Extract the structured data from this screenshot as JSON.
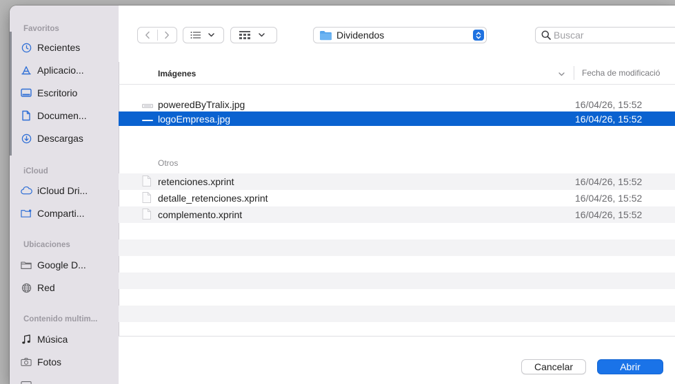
{
  "sidebar": {
    "favorites_header": "Favoritos",
    "favorites": [
      {
        "label": "Recientes",
        "icon": "clock-icon"
      },
      {
        "label": "Aplicacio...",
        "icon": "applications-icon"
      },
      {
        "label": "Escritorio",
        "icon": "desktop-icon"
      },
      {
        "label": "Documen...",
        "icon": "document-icon"
      },
      {
        "label": "Descargas",
        "icon": "download-icon"
      }
    ],
    "icloud_header": "iCloud",
    "icloud": [
      {
        "label": "iCloud Dri...",
        "icon": "cloud-icon"
      },
      {
        "label": "Comparti...",
        "icon": "shared-folder-icon"
      }
    ],
    "locations_header": "Ubicaciones",
    "locations": [
      {
        "label": "Google D...",
        "icon": "drive-icon"
      },
      {
        "label": "Red",
        "icon": "network-icon"
      }
    ],
    "media_header": "Contenido multim...",
    "media": [
      {
        "label": "Música",
        "icon": "music-icon"
      },
      {
        "label": "Fotos",
        "icon": "camera-icon"
      }
    ]
  },
  "toolbar": {
    "location": "Dividendos",
    "search_placeholder": "Buscar"
  },
  "list": {
    "name_header": "Imágenes",
    "date_header": "Fecha de modificació",
    "images": [
      {
        "name": "poweredByTralix.jpg",
        "date": "16/04/26, 15:52",
        "selected": false
      },
      {
        "name": "logoEmpresa.jpg",
        "date": "16/04/26, 15:52",
        "selected": true
      }
    ],
    "others_label": "Otros",
    "others": [
      {
        "name": "retenciones.xprint",
        "date": "16/04/26, 15:52"
      },
      {
        "name": "detalle_retenciones.xprint",
        "date": "16/04/26, 15:52"
      },
      {
        "name": "complemento.xprint",
        "date": "16/04/26, 15:52"
      }
    ]
  },
  "footer": {
    "cancel_label": "Cancelar",
    "open_label": "Abrir"
  },
  "colors": {
    "accent": "#1a73e8",
    "selection": "#0a62d0",
    "sidebar_bg": "#e4e1e7"
  }
}
